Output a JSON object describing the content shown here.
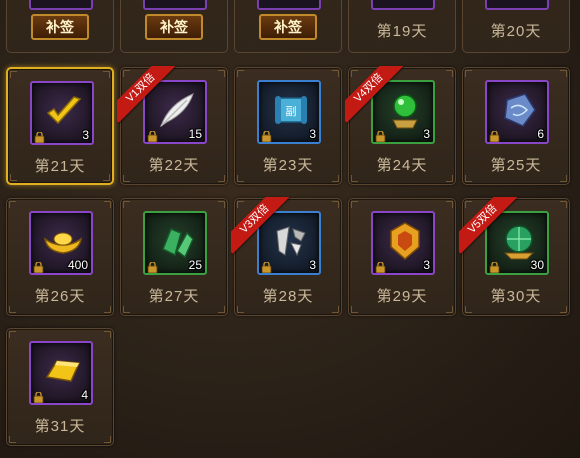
{
  "top_row": [
    {
      "type": "button",
      "label": "补签",
      "slot": "q-purple"
    },
    {
      "type": "button",
      "label": "补签",
      "slot": "q-green"
    },
    {
      "type": "button",
      "label": "补签",
      "slot": "q-blue"
    },
    {
      "type": "label",
      "label": "第19天",
      "slot": "q-purple"
    },
    {
      "type": "label",
      "label": "第20天",
      "slot": "q-green"
    }
  ],
  "days": [
    {
      "label": "第21天",
      "qty": "3",
      "quality": "q-purple",
      "icon": "checkmark-icon",
      "today": true,
      "ribbon": ""
    },
    {
      "label": "第22天",
      "qty": "15",
      "quality": "q-purple",
      "icon": "feather-icon",
      "today": false,
      "ribbon": "V1双倍"
    },
    {
      "label": "第23天",
      "qty": "3",
      "quality": "q-blue",
      "icon": "scroll-icon",
      "today": false,
      "ribbon": ""
    },
    {
      "label": "第24天",
      "qty": "3",
      "quality": "q-green",
      "icon": "orb-icon",
      "today": false,
      "ribbon": "V4双倍"
    },
    {
      "label": "第25天",
      "qty": "6",
      "quality": "q-purple",
      "icon": "crystal-icon",
      "today": false,
      "ribbon": ""
    },
    {
      "label": "第26天",
      "qty": "400",
      "quality": "q-purple",
      "icon": "gold-ingot-icon",
      "today": false,
      "ribbon": ""
    },
    {
      "label": "第27天",
      "qty": "25",
      "quality": "q-green",
      "icon": "jade-icon",
      "today": false,
      "ribbon": ""
    },
    {
      "label": "第28天",
      "qty": "3",
      "quality": "q-blue",
      "icon": "fragments-icon",
      "today": false,
      "ribbon": "V3双倍"
    },
    {
      "label": "第29天",
      "qty": "3",
      "quality": "q-purple",
      "icon": "emblem-icon",
      "today": false,
      "ribbon": ""
    },
    {
      "label": "第30天",
      "qty": "30",
      "quality": "q-green",
      "icon": "green-gem-icon",
      "today": false,
      "ribbon": "V5双倍"
    },
    {
      "label": "第31天",
      "qty": "4",
      "quality": "q-purple",
      "icon": "gold-bar-icon",
      "today": false,
      "ribbon": ""
    }
  ],
  "colors": {
    "today_border": "#e0b020",
    "ribbon": "#c41a14",
    "label": "#c9b89a"
  }
}
